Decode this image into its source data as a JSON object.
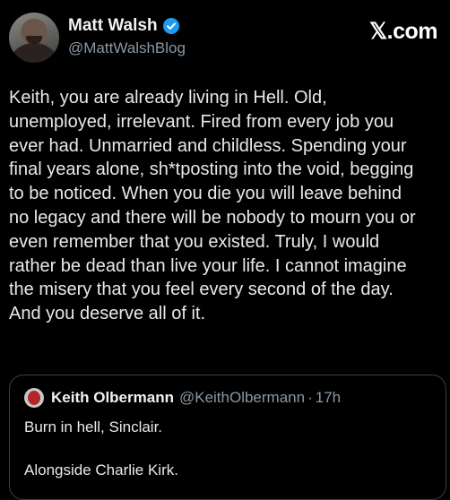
{
  "author": {
    "display_name": "Matt Walsh",
    "handle": "@MattWalshBlog",
    "verified_icon": "verified-badge-icon",
    "verified_color": "#1d9bf0"
  },
  "brand": "𝕏.com",
  "tweet": {
    "lines": [
      "Keith, you are already living in Hell. Old,",
      "unemployed, irrelevant. Fired from every job you",
      "ever had. Unmarried and childless. Spending your",
      "final years alone, sh*tposting into the void, begging",
      "to be noticed. When you die you will leave behind",
      "no legacy and there will be nobody to mourn you or",
      "even remember that you existed. Truly, I would",
      "rather be dead than live your life. I cannot imagine",
      "the misery that you feel every second of the day.",
      "And you deserve all of it."
    ]
  },
  "quote": {
    "display_name": "Keith Olbermann",
    "handle": "@KeithOlbermann",
    "separator": "·",
    "time": "17h",
    "line1": "Burn in hell, Sinclair.",
    "line2": "Alongside Charlie Kirk."
  }
}
